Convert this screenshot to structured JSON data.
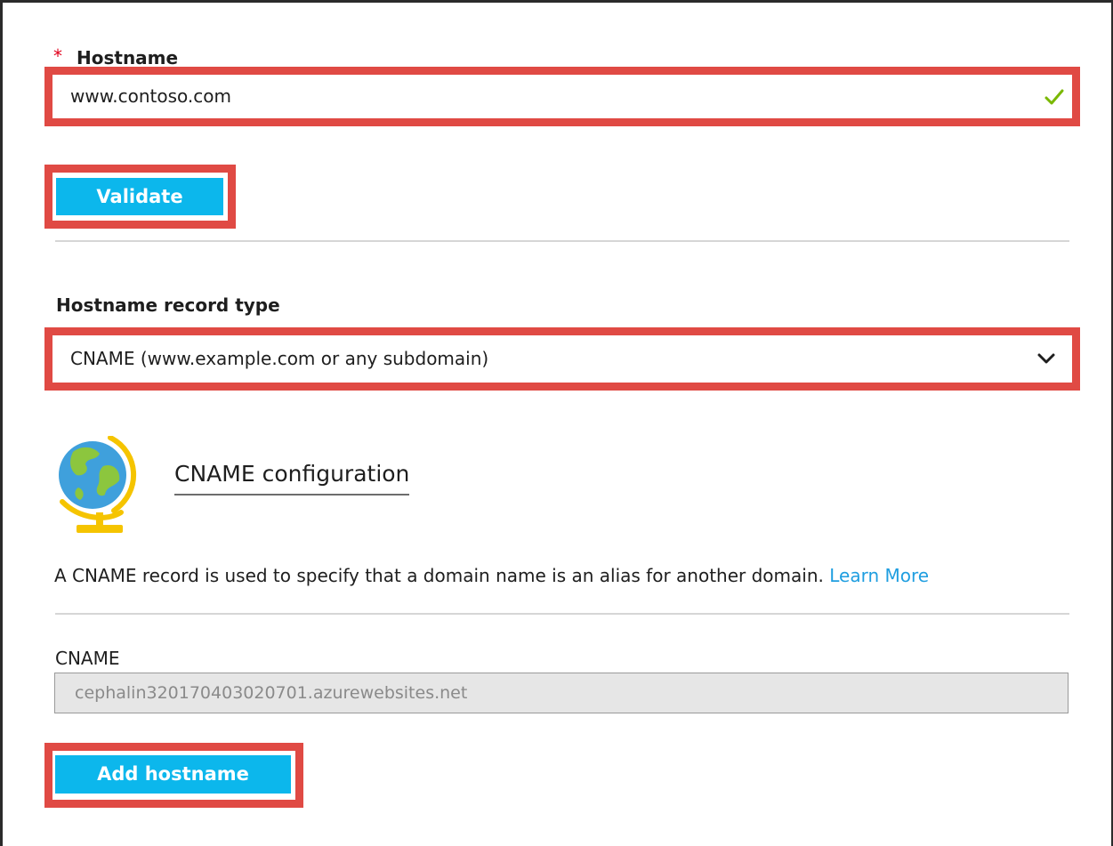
{
  "hostname": {
    "required_marker": "*",
    "label": "Hostname",
    "value": "www.contoso.com",
    "status_icon": "checkmark-icon"
  },
  "validate_button": {
    "label": "Validate"
  },
  "record_type": {
    "label": "Hostname record type",
    "selected": "CNAME (www.example.com or any subdomain)",
    "dropdown_icon": "chevron-down-icon"
  },
  "cname_config": {
    "icon": "globe-icon",
    "title": "CNAME configuration",
    "description": "A CNAME record is used to specify that a domain name is an alias for another domain.",
    "learn_more": "Learn More"
  },
  "cname_field": {
    "label": "CNAME",
    "value": "cephalin320170403020701.azurewebsites.net"
  },
  "add_button": {
    "label": "Add hostname"
  },
  "colors": {
    "accent_button": "#0cb7ec",
    "highlight_border": "#e04a44",
    "link": "#1f9ee0",
    "success": "#7ab800",
    "required": "#e0001b"
  }
}
